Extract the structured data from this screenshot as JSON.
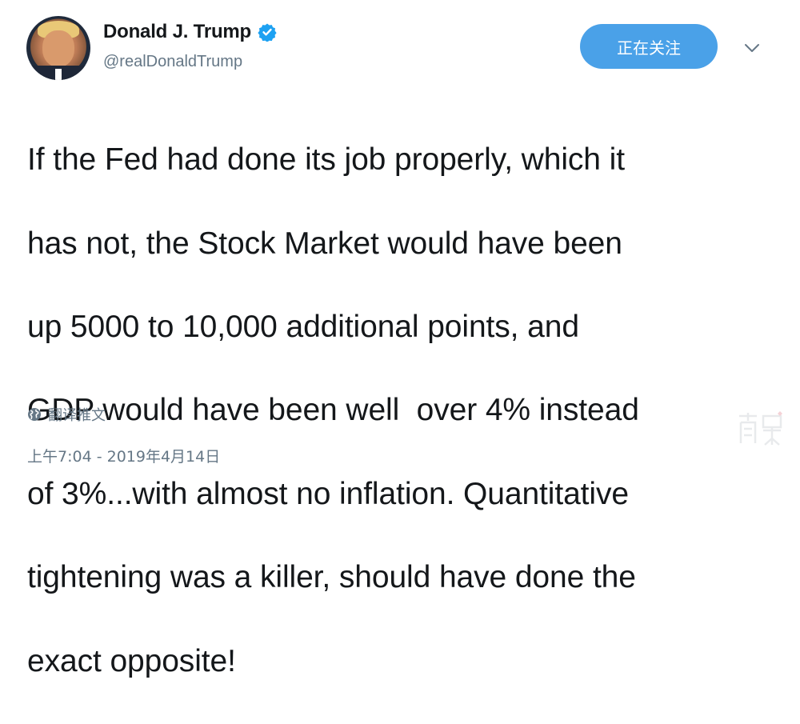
{
  "author": {
    "display_name": "Donald J. Trump",
    "handle": "@realDonaldTrump",
    "verified": true,
    "avatar_icon": "profile-photo"
  },
  "follow_button": {
    "label": "正在关注",
    "color": "#4aa1e8"
  },
  "menu": {
    "icon": "chevron-down-icon"
  },
  "tweet": {
    "text_lines": [
      "If the Fed had done its job properly, which it",
      "has not, the Stock Market would have been",
      "up 5000 to 10,000 additional points, and",
      "GDP would have been well  over 4% instead",
      "of 3%...with almost no inflation. Quantitative",
      "tightening was a killer, should have done the",
      "exact opposite!"
    ]
  },
  "translate": {
    "label": "翻译推文",
    "icon": "globe-icon"
  },
  "timestamp": "上午7:04 - 2019年4月14日",
  "colors": {
    "text": "#14171a",
    "secondary": "#657786",
    "verified": "#1da1f2"
  }
}
